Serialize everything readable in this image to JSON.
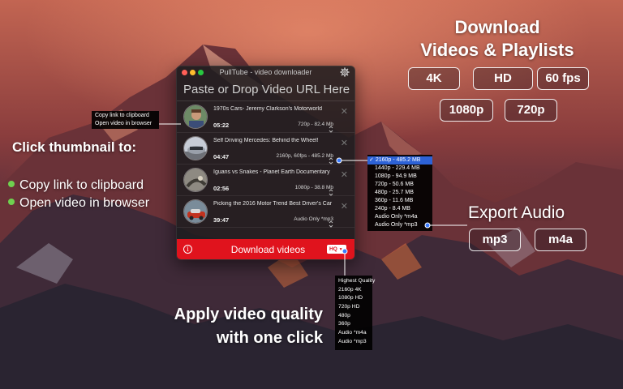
{
  "window": {
    "title": "PullTube - video downloader",
    "url_placeholder": "Paste or Drop Video URL Here",
    "download_button": "Download videos",
    "quality_select": "HQ"
  },
  "videos": [
    {
      "title": "1970s Cars- Jeremy Clarkson's Motorworld",
      "duration": "05:22",
      "format": "720p - 82.4 Mb"
    },
    {
      "title": "Self Driving Mercedes: Behind the Wheel!",
      "duration": "04:47",
      "format": "2160p, 60fps - 485.2 Mb"
    },
    {
      "title": "Iguans vs Snakes - Planet Earth Documentary",
      "duration": "02:56",
      "format": "1080p - 38.8 Mb"
    },
    {
      "title": "Picking the 2016 Motor Trend Best Driver's Car",
      "duration": "39:47",
      "format": "Audio Only *mp3"
    }
  ],
  "thumbnail_menu": [
    "Copy link to clipboard",
    "Open video in browser"
  ],
  "quality_dropdown": {
    "selected_mark": "✓",
    "options": [
      "2160p - 485.2 MB",
      "1440p - 229.4 MB",
      "1080p - 94.9 MB",
      "720p - 50.6 MB",
      "480p - 25.7 MB",
      "360p - 11.6 MB",
      "240p - 8.4 MB",
      "Audio Only *m4a",
      "Audio Only *mp3"
    ]
  },
  "preset_dropdown": [
    "Highest Quality",
    "2160p 4K",
    "1080p HD",
    "720p HD",
    "480p",
    "360p",
    "Audio *m4a",
    "Audio *mp3"
  ],
  "promo": {
    "download_heading_line1": "Download",
    "download_heading_line2": "Videos & Playlists",
    "badges": [
      "4K",
      "HD",
      "60 fps",
      "1080p",
      "720p"
    ],
    "click_heading": "Click thumbnail to:",
    "bullets": [
      "Copy link to clipboard",
      "Open video in browser"
    ],
    "apply_heading_line1": "Apply video quality",
    "apply_heading_line2": "with one click",
    "export_heading": "Export Audio",
    "audio_badges": [
      "mp3",
      "m4a"
    ]
  },
  "colors": {
    "accent_red": "#e0131d",
    "selection_blue": "#2d62d6",
    "bullet_green": "#6fd14f",
    "connector_blue": "#3a7bff"
  },
  "icons": [
    "gear-icon",
    "info-icon",
    "close-icon",
    "stepper-icon",
    "chevron-down-icon"
  ]
}
